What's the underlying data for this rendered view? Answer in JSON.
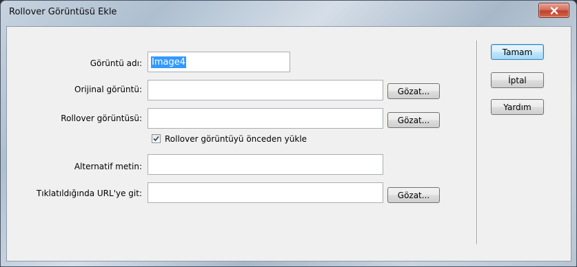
{
  "window": {
    "title": "Rollover Görüntüsü Ekle"
  },
  "form": {
    "image_name": {
      "label": "Görüntü adı:",
      "value": "Image4"
    },
    "original_image": {
      "label": "Orijinal görüntü:",
      "value": "",
      "browse_label": "Gözat..."
    },
    "rollover_image": {
      "label": "Rollover görüntüsü:",
      "value": "",
      "browse_label": "Gözat..."
    },
    "preload": {
      "label": "Rollover görüntüyü önceden yükle",
      "checked": true
    },
    "alt_text": {
      "label": "Alternatif metin:",
      "value": ""
    },
    "url": {
      "label": "Tıklatıldığında URL'ye git:",
      "value": "",
      "browse_label": "Gözat..."
    }
  },
  "buttons": {
    "ok": "Tamam",
    "cancel": "İptal",
    "help": "Yardım"
  },
  "icons": {
    "close": "close-icon",
    "checkmark": "checkmark-icon"
  }
}
